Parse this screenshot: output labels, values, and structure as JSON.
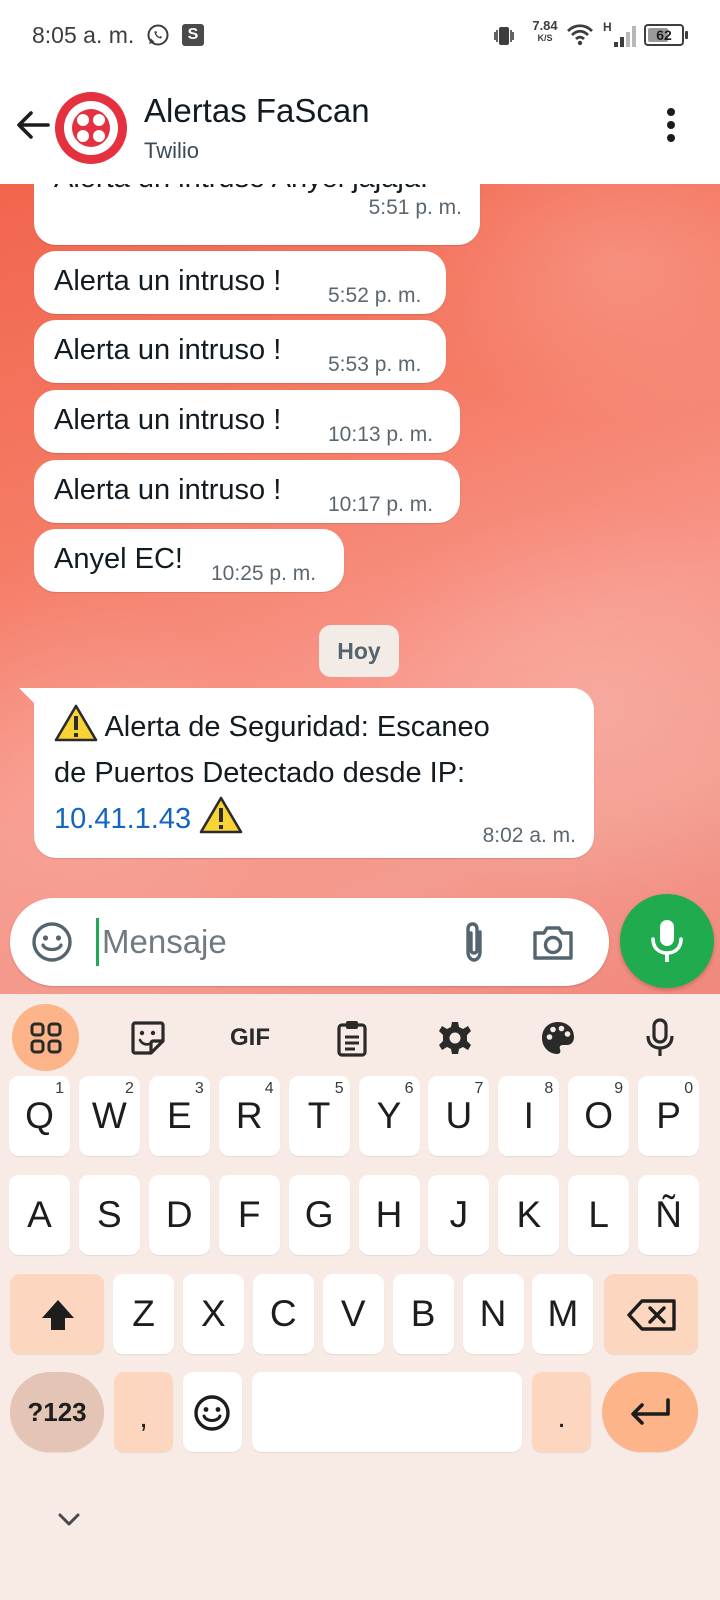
{
  "status_bar": {
    "time": "8:05 a. m.",
    "speed_value": "7.84",
    "speed_unit": "K/S",
    "network_type": "H",
    "battery": "62",
    "battery_level": 0.62,
    "icons": [
      "whatsapp-icon",
      "s-app-icon",
      "vibrate-icon",
      "wifi-icon",
      "signal-icon",
      "battery-icon"
    ]
  },
  "header": {
    "title": "Alertas FaScan",
    "subtitle": "Twilio",
    "avatar_color": "#e4303f"
  },
  "messages": [
    {
      "text": "Alerta un intruso Anyel jajaja!",
      "time": "5:51 p. m."
    },
    {
      "text": "Alerta un intruso !",
      "time": "5:52 p. m."
    },
    {
      "text": "Alerta un intruso !",
      "time": "5:53 p. m."
    },
    {
      "text": "Alerta un intruso !",
      "time": "10:13 p. m."
    },
    {
      "text": "Alerta un intruso !",
      "time": "10:17 p. m."
    },
    {
      "text": "Anyel EC!",
      "time": "10:25 p. m."
    }
  ],
  "date_separator": "Hoy",
  "alert_message": {
    "line1": "Alerta de Seguridad: Escaneo",
    "line2": "de Puertos Detectado desde IP:",
    "ip": "10.41.1.43",
    "time": "8:02 a. m.",
    "icon": "warning-icon"
  },
  "compose": {
    "placeholder": "Mensaje",
    "value": ""
  },
  "keyboard": {
    "toolbar": [
      "apps-icon",
      "sticker-icon",
      "GIF",
      "clipboard-icon",
      "settings-icon",
      "palette-icon",
      "voice-icon"
    ],
    "gif_label": "GIF",
    "row1": [
      {
        "k": "Q",
        "alt": "1"
      },
      {
        "k": "W",
        "alt": "2"
      },
      {
        "k": "E",
        "alt": "3"
      },
      {
        "k": "R",
        "alt": "4"
      },
      {
        "k": "T",
        "alt": "5"
      },
      {
        "k": "Y",
        "alt": "6"
      },
      {
        "k": "U",
        "alt": "7"
      },
      {
        "k": "I",
        "alt": "8"
      },
      {
        "k": "O",
        "alt": "9"
      },
      {
        "k": "P",
        "alt": "0"
      }
    ],
    "row2": [
      "A",
      "S",
      "D",
      "F",
      "G",
      "H",
      "J",
      "K",
      "L",
      "Ñ"
    ],
    "row3": [
      "Z",
      "X",
      "C",
      "V",
      "B",
      "N",
      "M"
    ],
    "symbols_label": "?123",
    "comma": ",",
    "period": ".",
    "accent_color": "#fcb488"
  }
}
